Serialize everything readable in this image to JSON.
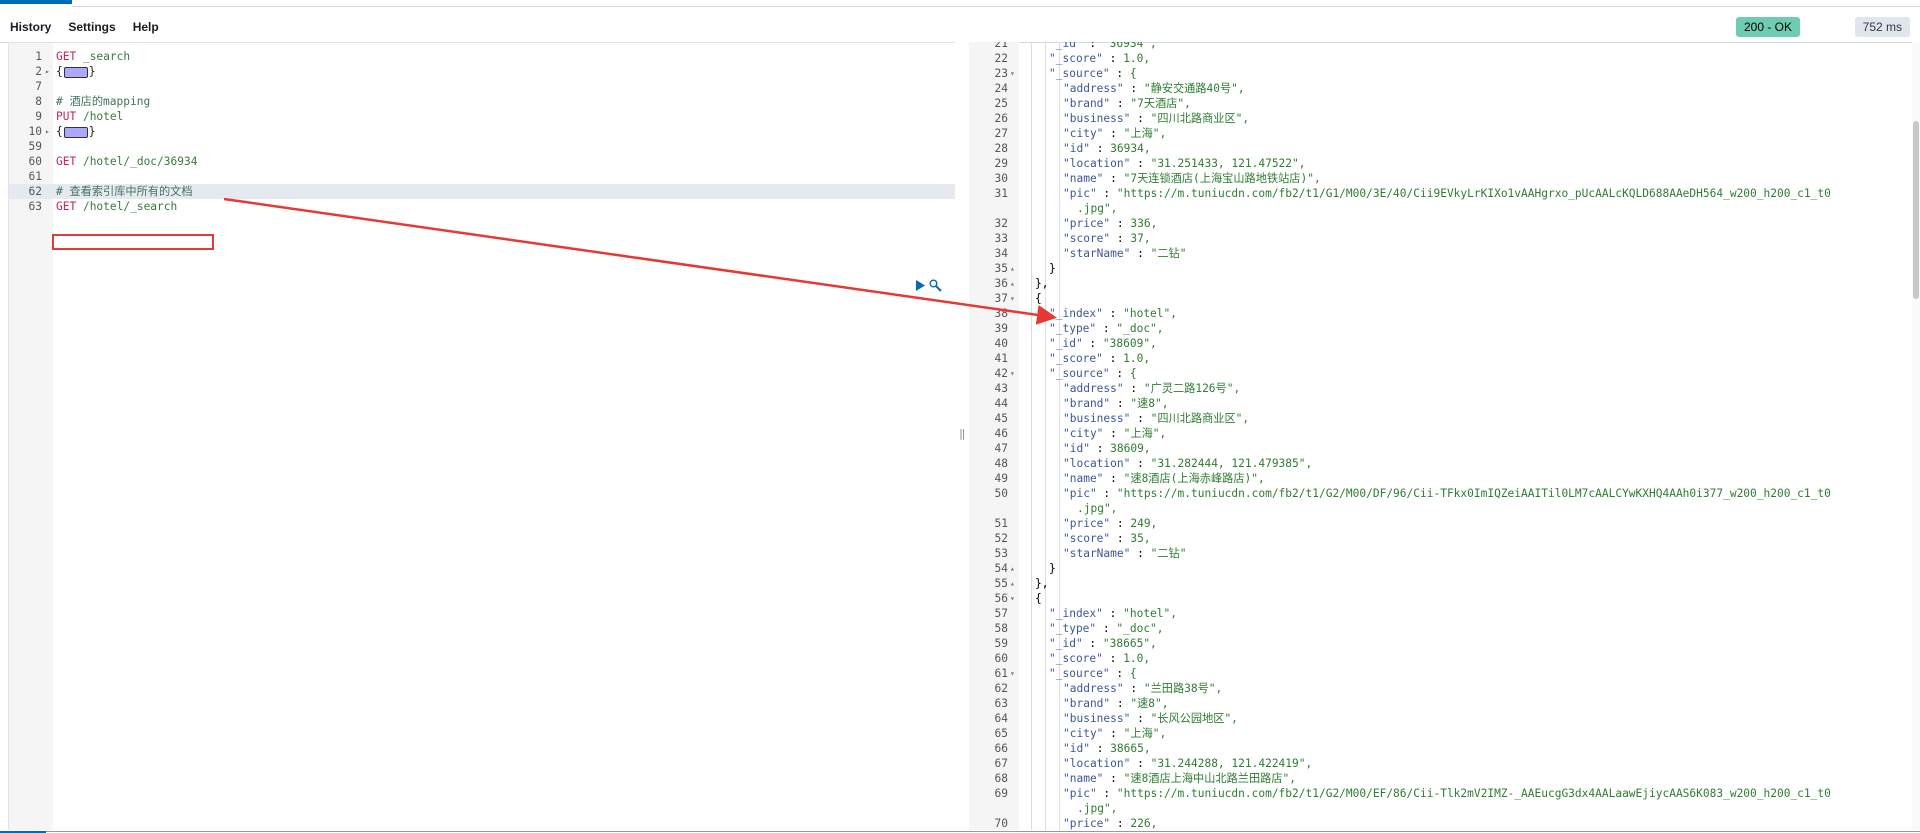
{
  "menu": {
    "history": "History",
    "settings": "Settings",
    "help": "Help"
  },
  "status": {
    "code": "200 - OK",
    "timing": "752 ms"
  },
  "editor": {
    "lines": [
      {
        "n": "1",
        "method": "GET",
        "path": " _search"
      },
      {
        "n": "2",
        "fold": "▸",
        "collapsed": true
      },
      {
        "n": "7"
      },
      {
        "n": "8",
        "comment": "# 酒店的mapping"
      },
      {
        "n": "9",
        "method": "PUT",
        "path": " /hotel"
      },
      {
        "n": "10",
        "fold": "▸",
        "collapsed": true
      },
      {
        "n": "59"
      },
      {
        "n": "60",
        "method": "GET",
        "path": " /hotel/_doc/36934"
      },
      {
        "n": "61"
      },
      {
        "n": "62",
        "comment": "# 查看索引库中所有的文档",
        "highlight": true
      },
      {
        "n": "63",
        "method": "GET",
        "path": " /hotel/_search"
      }
    ]
  },
  "output": {
    "lines": [
      {
        "n": "21",
        "i": 2,
        "t": "\"_id\" : \"36934\","
      },
      {
        "n": "22",
        "i": 2,
        "t": "\"_score\" : 1.0,"
      },
      {
        "n": "23",
        "i": 2,
        "f": "▾",
        "t": "\"_source\" : {"
      },
      {
        "n": "24",
        "i": 3,
        "t": "\"address\" : \"静安交通路40号\","
      },
      {
        "n": "25",
        "i": 3,
        "t": "\"brand\" : \"7天酒店\","
      },
      {
        "n": "26",
        "i": 3,
        "t": "\"business\" : \"四川北路商业区\","
      },
      {
        "n": "27",
        "i": 3,
        "t": "\"city\" : \"上海\","
      },
      {
        "n": "28",
        "i": 3,
        "t": "\"id\" : 36934,"
      },
      {
        "n": "29",
        "i": 3,
        "t": "\"location\" : \"31.251433, 121.47522\","
      },
      {
        "n": "30",
        "i": 3,
        "t": "\"name\" : \"7天连锁酒店(上海宝山路地铁站店)\","
      },
      {
        "n": "31",
        "i": 3,
        "t": "\"pic\" : \"https://m.tuniucdn.com/fb2/t1/G1/M00/3E/40/Cii9EVkyLrKIXo1vAAHgrxo_pUcAALcKQLD688AAeDH564_w200_h200_c1_t0"
      },
      {
        "n": "",
        "i": 4,
        "t": ".jpg\","
      },
      {
        "n": "32",
        "i": 3,
        "t": "\"price\" : 336,"
      },
      {
        "n": "33",
        "i": 3,
        "t": "\"score\" : 37,"
      },
      {
        "n": "34",
        "i": 3,
        "t": "\"starName\" : \"二钻\""
      },
      {
        "n": "35",
        "i": 2,
        "f": "▴",
        "t": "}"
      },
      {
        "n": "36",
        "i": 1,
        "f": "▴",
        "t": "},"
      },
      {
        "n": "37",
        "i": 1,
        "f": "▾",
        "t": "{"
      },
      {
        "n": "38",
        "i": 2,
        "t": "\"_index\" : \"hotel\","
      },
      {
        "n": "39",
        "i": 2,
        "t": "\"_type\" : \"_doc\","
      },
      {
        "n": "40",
        "i": 2,
        "t": "\"_id\" : \"38609\","
      },
      {
        "n": "41",
        "i": 2,
        "t": "\"_score\" : 1.0,"
      },
      {
        "n": "42",
        "i": 2,
        "f": "▾",
        "t": "\"_source\" : {"
      },
      {
        "n": "43",
        "i": 3,
        "t": "\"address\" : \"广灵二路126号\","
      },
      {
        "n": "44",
        "i": 3,
        "t": "\"brand\" : \"速8\","
      },
      {
        "n": "45",
        "i": 3,
        "t": "\"business\" : \"四川北路商业区\","
      },
      {
        "n": "46",
        "i": 3,
        "t": "\"city\" : \"上海\","
      },
      {
        "n": "47",
        "i": 3,
        "t": "\"id\" : 38609,"
      },
      {
        "n": "48",
        "i": 3,
        "t": "\"location\" : \"31.282444, 121.479385\","
      },
      {
        "n": "49",
        "i": 3,
        "t": "\"name\" : \"速8酒店(上海赤峰路店)\","
      },
      {
        "n": "50",
        "i": 3,
        "t": "\"pic\" : \"https://m.tuniucdn.com/fb2/t1/G2/M00/DF/96/Cii-TFkx0ImIQZeiAAITil0LM7cAALCYwKXHQ4AAh0i377_w200_h200_c1_t0"
      },
      {
        "n": "",
        "i": 4,
        "t": ".jpg\","
      },
      {
        "n": "51",
        "i": 3,
        "t": "\"price\" : 249,"
      },
      {
        "n": "52",
        "i": 3,
        "t": "\"score\" : 35,"
      },
      {
        "n": "53",
        "i": 3,
        "t": "\"starName\" : \"二钻\""
      },
      {
        "n": "54",
        "i": 2,
        "f": "▴",
        "t": "}"
      },
      {
        "n": "55",
        "i": 1,
        "f": "▴",
        "t": "},"
      },
      {
        "n": "56",
        "i": 1,
        "f": "▾",
        "t": "{"
      },
      {
        "n": "57",
        "i": 2,
        "t": "\"_index\" : \"hotel\","
      },
      {
        "n": "58",
        "i": 2,
        "t": "\"_type\" : \"_doc\","
      },
      {
        "n": "59",
        "i": 2,
        "t": "\"_id\" : \"38665\","
      },
      {
        "n": "60",
        "i": 2,
        "t": "\"_score\" : 1.0,"
      },
      {
        "n": "61",
        "i": 2,
        "f": "▾",
        "t": "\"_source\" : {"
      },
      {
        "n": "62",
        "i": 3,
        "t": "\"address\" : \"兰田路38号\","
      },
      {
        "n": "63",
        "i": 3,
        "t": "\"brand\" : \"速8\","
      },
      {
        "n": "64",
        "i": 3,
        "t": "\"business\" : \"长风公园地区\","
      },
      {
        "n": "65",
        "i": 3,
        "t": "\"city\" : \"上海\","
      },
      {
        "n": "66",
        "i": 3,
        "t": "\"id\" : 38665,"
      },
      {
        "n": "67",
        "i": 3,
        "t": "\"location\" : \"31.244288, 121.422419\","
      },
      {
        "n": "68",
        "i": 3,
        "t": "\"name\" : \"速8酒店上海中山北路兰田路店\","
      },
      {
        "n": "69",
        "i": 3,
        "t": "\"pic\" : \"https://m.tuniucdn.com/fb2/t1/G2/M00/EF/86/Cii-Tlk2mV2IMZ-_AAEucgG3dx4AALaawEjiycAAS6K083_w200_h200_c1_t0"
      },
      {
        "n": "",
        "i": 4,
        "t": ".jpg\","
      },
      {
        "n": "70",
        "i": 3,
        "t": "\"price\" : 226,"
      }
    ]
  }
}
